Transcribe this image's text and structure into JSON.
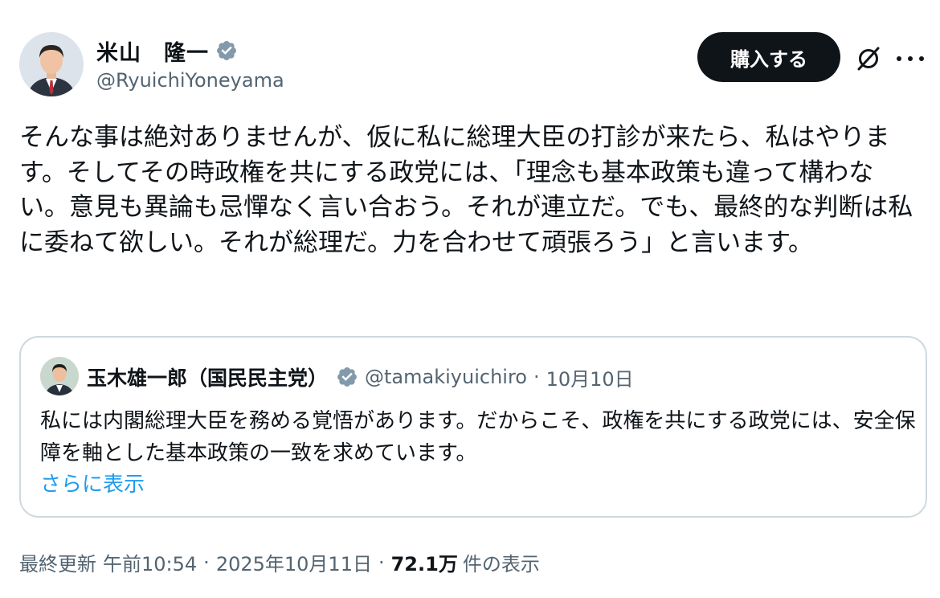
{
  "author": {
    "display_name": "米山　隆一",
    "handle": "@RyuichiYoneyama",
    "verified_color": "#829aab"
  },
  "actions": {
    "buy_label": "購入する",
    "grok_icon": "grok-icon",
    "more_icon": "more-icon"
  },
  "post": {
    "text": "そんな事は絶対ありませんが、仮に私に総理大臣の打診が来たら、私はやります。そしてその時政権を共にする政党には、「理念も基本政策も違って構わない。意見も異論も忌憚なく言い合おう。それが連立だ。でも、最終的な判断は私に委ねて欲しい。それが総理だ。力を合わせて頑張ろう」と言います。"
  },
  "quote": {
    "display_name": "玉木雄一郎（国民民主党）",
    "handle": "@tamakiyuichiro",
    "separator": "·",
    "date": "10月10日",
    "text": "私には内閣総理大臣を務める覚悟があります。だからこそ、政権を共にする政党には、安全保障を軸とした基本政策の一致を求めています。",
    "show_more": "さらに表示"
  },
  "meta": {
    "updated_label": "最終更新",
    "time": "午前10:54",
    "separator": "·",
    "date": "2025年10月11日",
    "views": "72.1万",
    "views_label": "件の表示"
  },
  "colors": {
    "text": "#0f1419",
    "secondary": "#536471",
    "link": "#1d9bf0",
    "border": "#cfd9de"
  }
}
